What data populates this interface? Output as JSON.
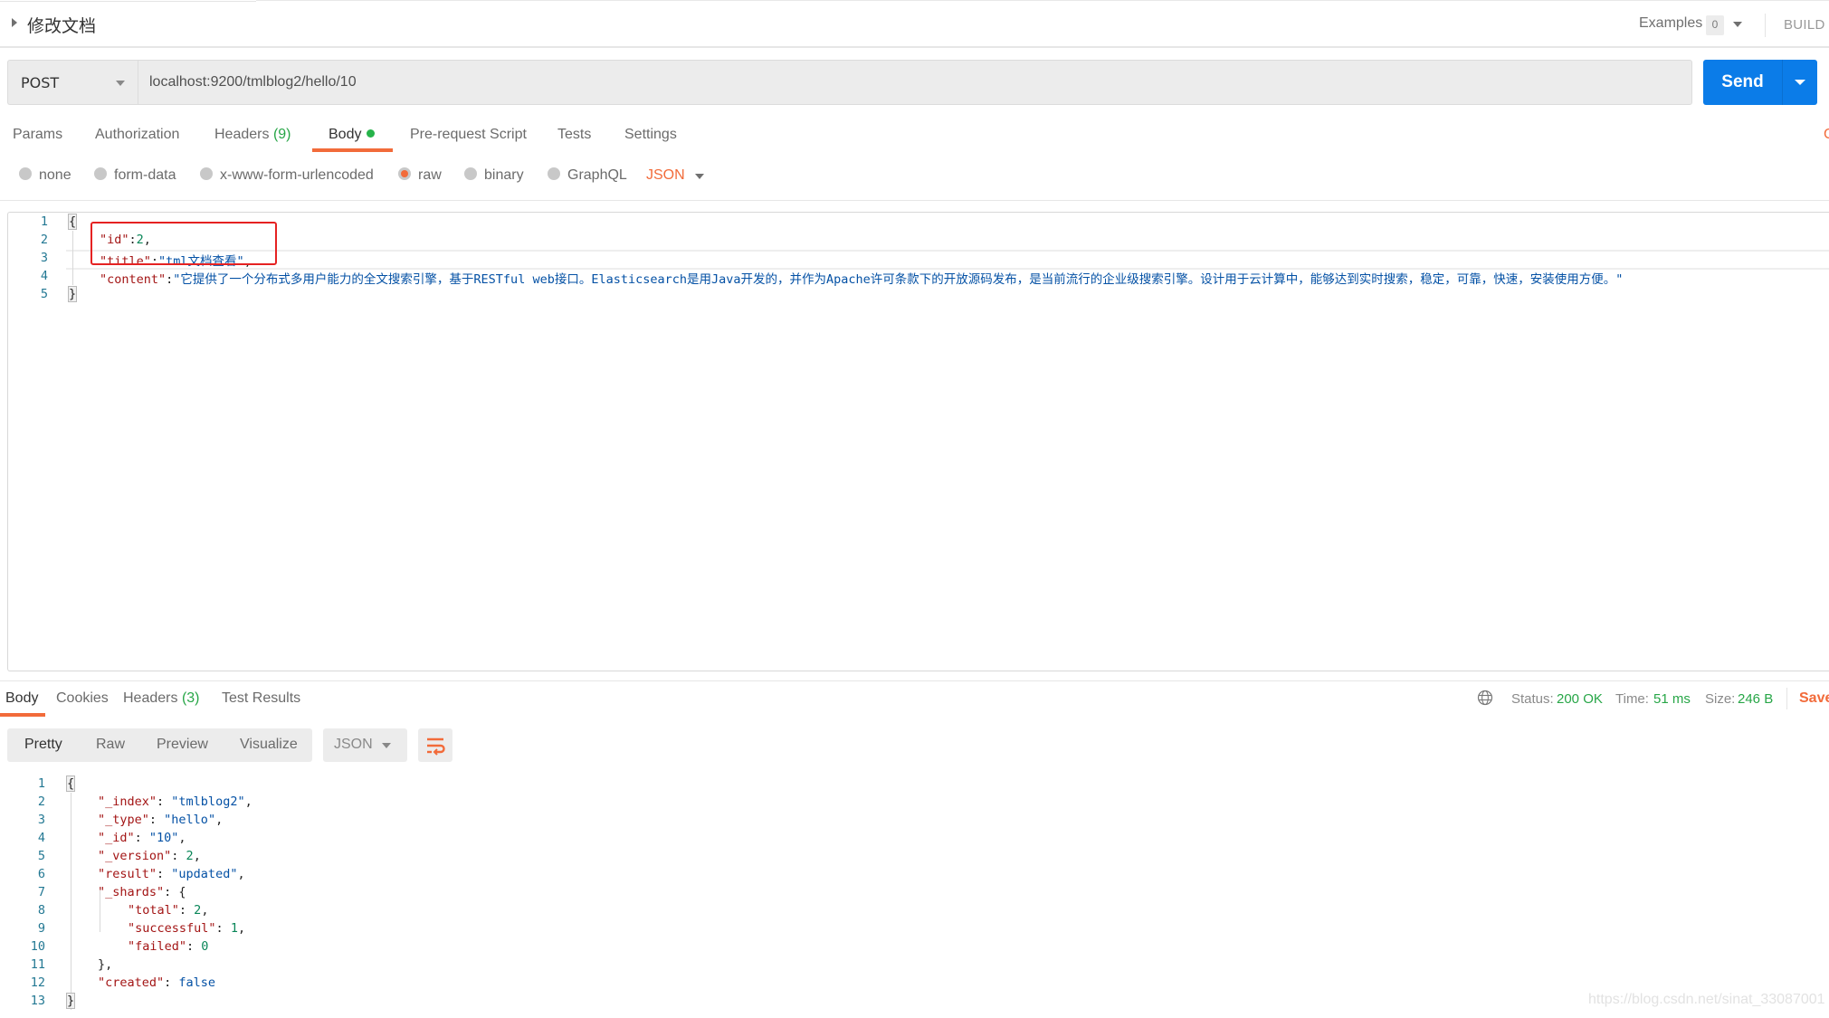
{
  "header": {
    "request_title": "修改文档",
    "examples_label": "Examples",
    "examples_count": "0",
    "build_label": "BUILD"
  },
  "request": {
    "method": "POST",
    "url": "localhost:9200/tmlblog2/hello/10",
    "send_label": "Send"
  },
  "request_tabs": {
    "params": "Params",
    "authorization": "Authorization",
    "headers": "Headers",
    "headers_count": "(9)",
    "body": "Body",
    "pre_request_script": "Pre-request Script",
    "tests": "Tests",
    "settings": "Settings",
    "cookies_cut": "C"
  },
  "body_options": {
    "none": "none",
    "form_data": "form-data",
    "urlencoded": "x-www-form-urlencoded",
    "raw": "raw",
    "binary": "binary",
    "graphql": "GraphQL",
    "format": "JSON",
    "selected": "raw"
  },
  "request_body": {
    "line_numbers": [
      "1",
      "2",
      "3",
      "4",
      "5"
    ],
    "open_brace": "{",
    "close_brace": "}",
    "id_key": "\"id\"",
    "id_value": "2",
    "title_key": "\"title\"",
    "title_value": "\"tml文档查看\"",
    "content_key": "\"content\"",
    "content_value": "\"它提供了一个分布式多用户能力的全文搜索引擎，基于RESTful web接口。Elasticsearch是用Java开发的，并作为Apache许可条款下的开放源码发布，是当前流行的企业级搜索引擎。设计用于云计算中，能够达到实时搜索，稳定，可靠，快速，安装使用方便。\""
  },
  "response_tabs": {
    "body": "Body",
    "cookies": "Cookies",
    "headers": "Headers",
    "headers_count": "(3)",
    "test_results": "Test Results"
  },
  "response_status": {
    "status_label": "Status:",
    "status_value": "200 OK",
    "time_label": "Time:",
    "time_value": "51 ms",
    "size_label": "Size:",
    "size_value": "246 B",
    "save_label": "Save"
  },
  "response_toolbar": {
    "pretty": "Pretty",
    "raw": "Raw",
    "preview": "Preview",
    "visualize": "Visualize",
    "format": "JSON"
  },
  "response_body": {
    "line_numbers": [
      "1",
      "2",
      "3",
      "4",
      "5",
      "6",
      "7",
      "8",
      "9",
      "10",
      "11",
      "12",
      "13"
    ],
    "open_brace": "{",
    "close_brace": "}",
    "index_key": "\"_index\"",
    "index_value": "\"tmlblog2\"",
    "type_key": "\"_type\"",
    "type_value": "\"hello\"",
    "id_key": "\"_id\"",
    "id_value": "\"10\"",
    "version_key": "\"_version\"",
    "version_value": "2",
    "result_key": "\"result\"",
    "result_value": "\"updated\"",
    "shards_key": "\"_shards\"",
    "total_key": "\"total\"",
    "total_value": "2",
    "successful_key": "\"successful\"",
    "successful_value": "1",
    "failed_key": "\"failed\"",
    "failed_value": "0",
    "created_key": "\"created\"",
    "created_value": "false"
  },
  "colors": {
    "accent": "#f26b3a",
    "send_blue": "#0b7ce8",
    "success_green": "#27a647",
    "highlight_box": "#e52222"
  },
  "watermark": "https://blog.csdn.net/sinat_33087001"
}
